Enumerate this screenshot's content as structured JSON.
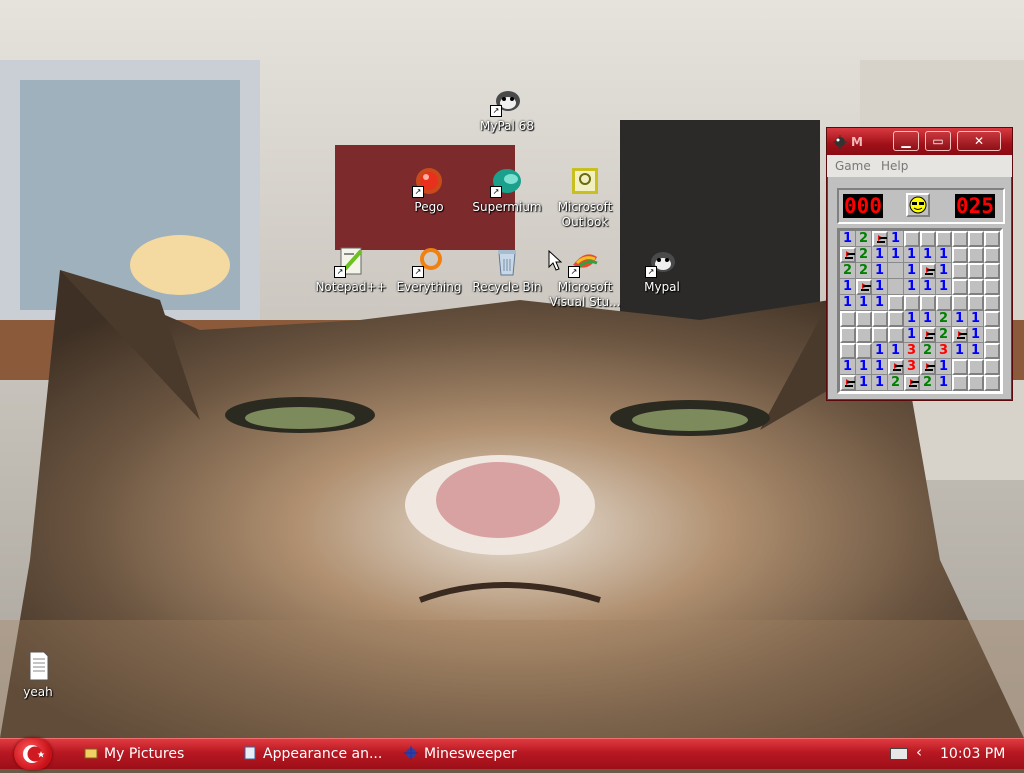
{
  "desktop": {
    "icons": [
      {
        "label": "MyPal 68"
      },
      {
        "label": "Pego"
      },
      {
        "label": "Supermium"
      },
      {
        "label": "Microsoft Outlook"
      },
      {
        "label": "Notepad++"
      },
      {
        "label": "Everything"
      },
      {
        "label": "Recycle Bin"
      },
      {
        "label": "Microsoft Visual Stu..."
      },
      {
        "label": "Mypal"
      },
      {
        "label": "yeah"
      }
    ]
  },
  "minesweeper": {
    "title": "M",
    "menu": {
      "game": "Game",
      "help": "Help"
    },
    "mine_counter": "000",
    "timer": "025",
    "face": "sunglasses",
    "grid": [
      [
        "1",
        "2",
        "F",
        "1",
        " ",
        " ",
        " ",
        " ",
        " ",
        " "
      ],
      [
        "F",
        "2",
        "1",
        "1",
        "1",
        "1",
        "1",
        " ",
        " ",
        " "
      ],
      [
        "2",
        "2",
        "1",
        " ",
        "1",
        "F",
        "1",
        " ",
        " ",
        " "
      ],
      [
        "1",
        "F",
        "1",
        " ",
        "1",
        "1",
        "1",
        " ",
        " ",
        " "
      ],
      [
        "1",
        "1",
        "1",
        " ",
        " ",
        " ",
        " ",
        " ",
        " ",
        " "
      ],
      [
        " ",
        " ",
        " ",
        " ",
        "1",
        "1",
        "2",
        "1",
        "1",
        " "
      ],
      [
        " ",
        " ",
        " ",
        " ",
        "1",
        "F",
        "2",
        "F",
        "1",
        " "
      ],
      [
        " ",
        " ",
        "1",
        "1",
        "3",
        "2",
        "3",
        "1",
        "1",
        " "
      ],
      [
        "1",
        "1",
        "1",
        "F",
        "3",
        "F",
        "1",
        " ",
        " ",
        " "
      ],
      [
        "F",
        "1",
        "1",
        "2",
        "F",
        "2",
        "1",
        " ",
        " ",
        " "
      ]
    ],
    "grid_hidden_map": [
      "....######",
      ".......###",
      ".......###",
      ".......###",
      "...#######",
      "####.....#",
      "####.....#",
      "##.......#",
      ".......###",
      ".......###"
    ]
  },
  "taskbar": {
    "tasks": [
      {
        "label": "My Pictures"
      },
      {
        "label": "Appearance an..."
      },
      {
        "label": "Minesweeper"
      }
    ],
    "clock": "10:03 PM"
  },
  "colors": {
    "taskbar_accent": "#b81822",
    "title_accent": "#a01018"
  }
}
